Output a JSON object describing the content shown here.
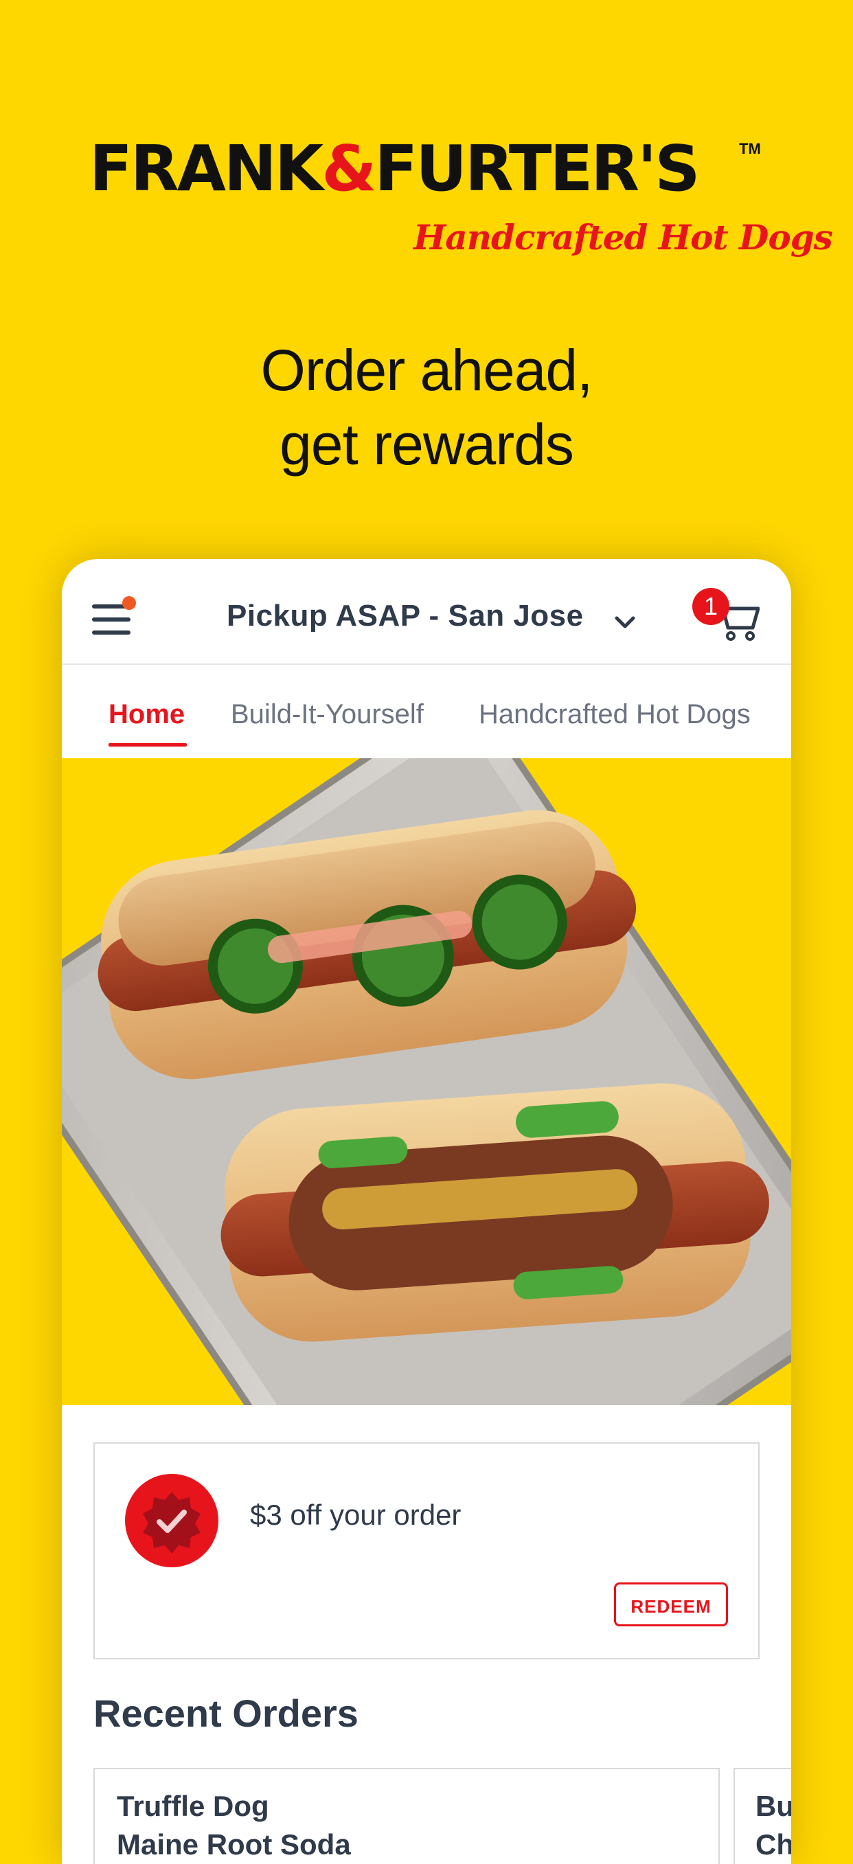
{
  "brand": {
    "name_part1": "FRANK",
    "ampersand": "&",
    "name_part2": "FURTER'S",
    "trademark": "TM",
    "subtitle": "Handcrafted Hot Dogs"
  },
  "tagline": {
    "line1": "Order ahead,",
    "line2": "get rewards"
  },
  "app": {
    "header": {
      "location_label": "Pickup ASAP - San Jose",
      "cart_count": "1"
    },
    "tabs": [
      {
        "label": "Home",
        "active": true
      },
      {
        "label": "Build-It-Yourself",
        "active": false
      },
      {
        "label": "Handcrafted Hot Dogs",
        "active": false
      }
    ],
    "reward": {
      "text": "$3 off your order",
      "button_label": "REDEEM"
    },
    "recent_orders": {
      "title": "Recent Orders",
      "cards": [
        {
          "line1": "Truffle Dog",
          "line2": "Maine Root Soda"
        },
        {
          "line1": "Bu",
          "line2": "Ch"
        }
      ]
    }
  },
  "colors": {
    "brand_yellow": "#FFD700",
    "brand_red": "#E8141B",
    "text_dark": "#2f3a4a",
    "menu_dot": "#F05A22"
  }
}
